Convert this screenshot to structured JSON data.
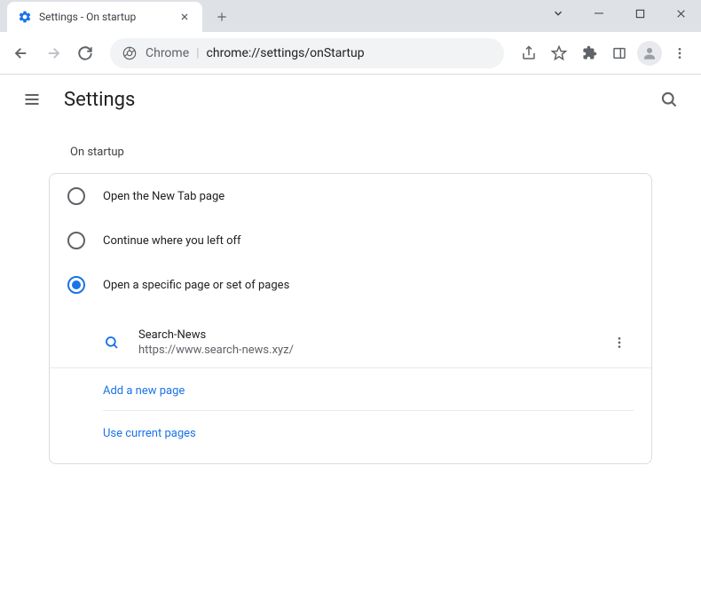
{
  "tab": {
    "title": "Settings - On startup"
  },
  "address": {
    "prefix": "Chrome",
    "url": "chrome://settings/onStartup"
  },
  "header": {
    "title": "Settings"
  },
  "section": {
    "title": "On startup"
  },
  "options": {
    "newtab": "Open the New Tab page",
    "continue": "Continue where you left off",
    "specific": "Open a specific page or set of pages"
  },
  "startup_page": {
    "name": "Search-News",
    "url": "https://www.search-news.xyz/"
  },
  "actions": {
    "add_page": "Add a new page",
    "use_current": "Use current pages"
  }
}
